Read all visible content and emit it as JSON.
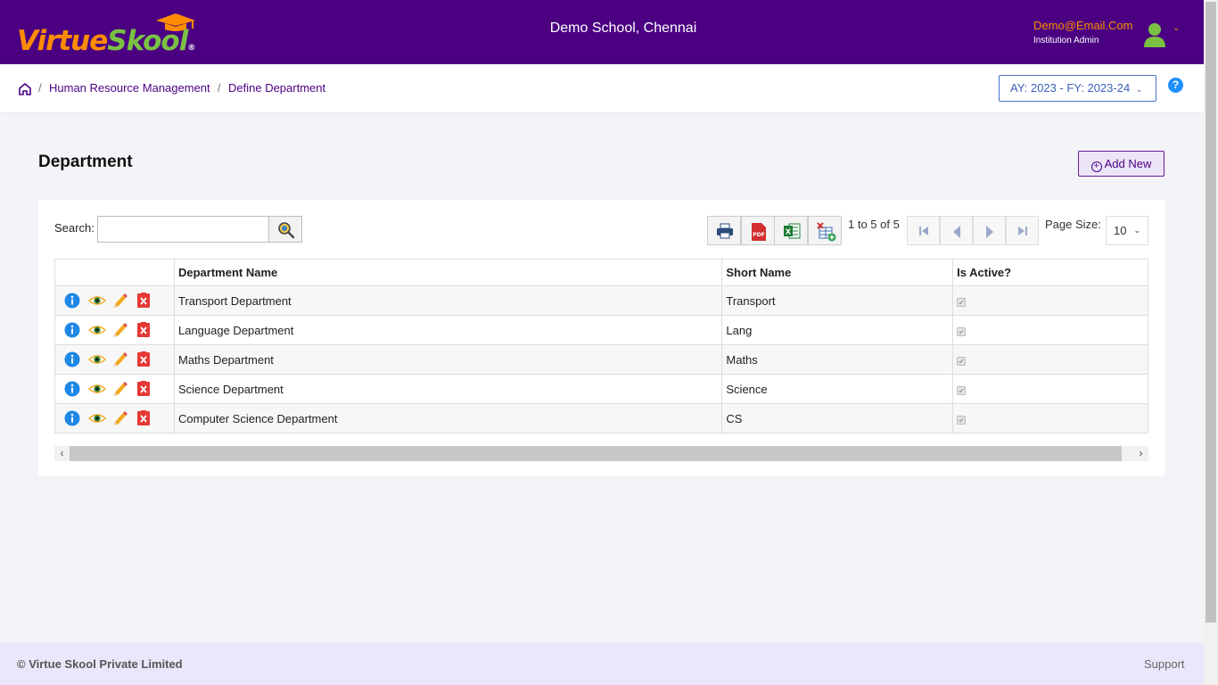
{
  "header": {
    "logo_part1": "Virtue",
    "logo_part2": "Skool",
    "logo_reg": "®",
    "school_name": "Demo School, Chennai",
    "user_email": "Demo@Email.Com",
    "user_role": "Institution Admin",
    "icons": [
      "graduation-cap-icon",
      "user-avatar-icon",
      "chevron-down-icon"
    ],
    "colors": {
      "brand": "#4b0082",
      "accent": "#ff8c00",
      "green": "#7ac143"
    }
  },
  "breadcrumb": {
    "items": [
      "Human Resource Management",
      "Define Department"
    ],
    "separator": "/"
  },
  "academic_year": {
    "label": "AY: 2023 - FY: 2023-24"
  },
  "help": {
    "label": "?"
  },
  "page": {
    "title": "Department",
    "add_new_label": "Add New"
  },
  "toolbar": {
    "search_label": "Search:",
    "search_value": "",
    "page_info": "1 to 5 of 5",
    "page_size_label": "Page Size:",
    "page_size_value": "10",
    "tools": [
      "print-icon",
      "pdf-export-icon",
      "excel-export-icon",
      "add-column-icon"
    ]
  },
  "table": {
    "columns": [
      "",
      "Department Name",
      "Short Name",
      "Is Active?"
    ],
    "rows": [
      {
        "name": "Transport Department",
        "short": "Transport",
        "active": true
      },
      {
        "name": "Language Department",
        "short": "Lang",
        "active": true
      },
      {
        "name": "Maths Department",
        "short": "Maths",
        "active": true
      },
      {
        "name": "Science Department",
        "short": "Science",
        "active": true
      },
      {
        "name": "Computer Science Department",
        "short": "CS",
        "active": true
      }
    ],
    "row_actions": [
      "info-icon",
      "view-icon",
      "edit-icon",
      "delete-icon"
    ]
  },
  "footer": {
    "copyright": "© Virtue Skool Private Limited",
    "support": "Support"
  }
}
